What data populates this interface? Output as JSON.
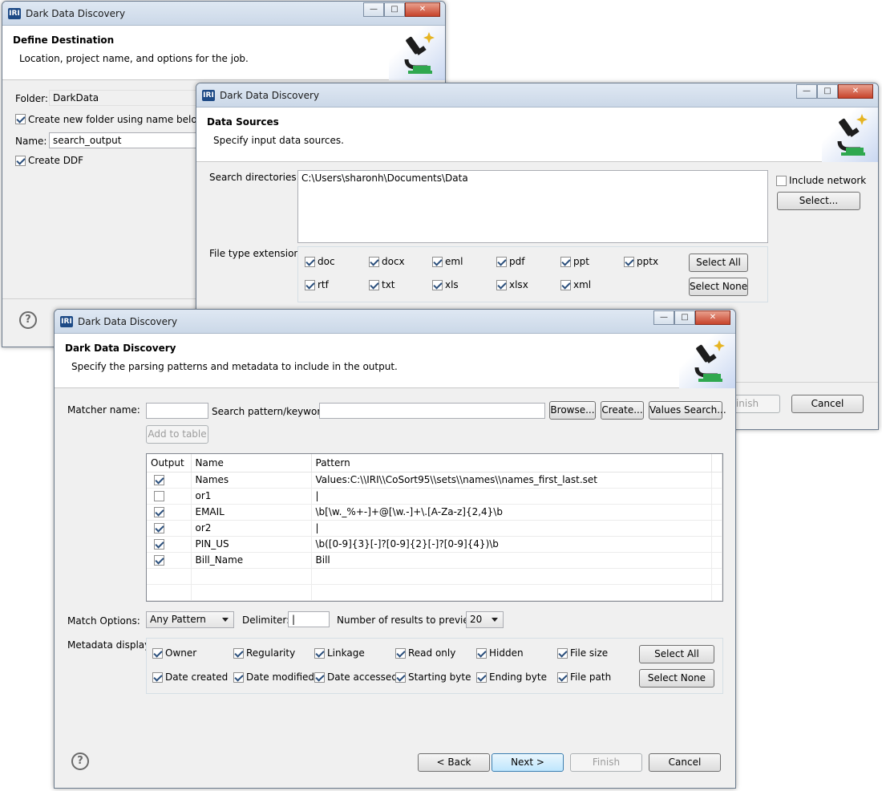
{
  "windows": {
    "back": {
      "title": "Dark Data Discovery",
      "header_title": "Define Destination",
      "header_desc": "Location, project name, and options for the job.",
      "folder_label": "Folder:",
      "folder_value": "DarkData",
      "create_folder_label": "Create new folder using name below",
      "name_label": "Name:",
      "name_value": "search_output",
      "create_ddf_label": "Create DDF"
    },
    "middle": {
      "title": "Dark Data Discovery",
      "header_title": "Data Sources",
      "header_desc": "Specify input data sources.",
      "search_dirs_label": "Search directories:",
      "search_dirs_value": "C:\\Users\\sharonh\\Documents\\Data",
      "include_network_label": "Include network",
      "select_button": "Select...",
      "file_types_label": "File type extensions:",
      "file_types": [
        "doc",
        "docx",
        "eml",
        "pdf",
        "ppt",
        "pptx",
        "rtf",
        "txt",
        "xls",
        "xlsx",
        "xml"
      ],
      "select_all": "Select All",
      "select_none": "Select None",
      "finish": "Finish",
      "cancel": "Cancel"
    },
    "front": {
      "title": "Dark Data Discovery",
      "header_title": "Dark Data Discovery",
      "header_desc": "Specify the parsing patterns and metadata to include in the output.",
      "matcher_name_label": "Matcher name:",
      "matcher_name_value": "",
      "search_pattern_label": "Search pattern/keyword:",
      "search_pattern_value": "",
      "browse": "Browse...",
      "create": "Create...",
      "values_search": "Values Search...",
      "add_to_table": "Add to table",
      "table_headers": [
        "Output",
        "Name",
        "Pattern"
      ],
      "table_rows": [
        {
          "checked": true,
          "name": "Names",
          "pattern": "Values:C:\\\\IRI\\\\CoSort95\\\\sets\\\\names\\\\names_first_last.set"
        },
        {
          "checked": false,
          "name": "or1",
          "pattern": "|"
        },
        {
          "checked": true,
          "name": "EMAIL",
          "pattern": "\\b[\\w._%+-]+@[\\w.-]+\\.[A-Za-z]{2,4}\\b"
        },
        {
          "checked": true,
          "name": "or2",
          "pattern": "|"
        },
        {
          "checked": true,
          "name": "PIN_US",
          "pattern": "\\b([0-9]{3}[-]?[0-9]{2}[-]?[0-9]{4})\\b"
        },
        {
          "checked": true,
          "name": "Bill_Name",
          "pattern": "Bill"
        }
      ],
      "match_options_label": "Match Options:",
      "match_options_value": "Any Pattern",
      "delimiter_label": "Delimiter:",
      "delimiter_value": "|",
      "num_results_label": "Number of results to preview:",
      "num_results_value": "20",
      "metadata_label": "Metadata display:",
      "metadata_row1": [
        "Owner",
        "Regularity",
        "Linkage",
        "Read only",
        "Hidden",
        "File size"
      ],
      "metadata_row2": [
        "Date created",
        "Date modified",
        "Date accessed",
        "Starting byte",
        "Ending byte",
        "File path"
      ],
      "select_all": "Select All",
      "select_none": "Select None",
      "back": "< Back",
      "next": "Next >",
      "finish": "Finish",
      "cancel": "Cancel"
    }
  }
}
